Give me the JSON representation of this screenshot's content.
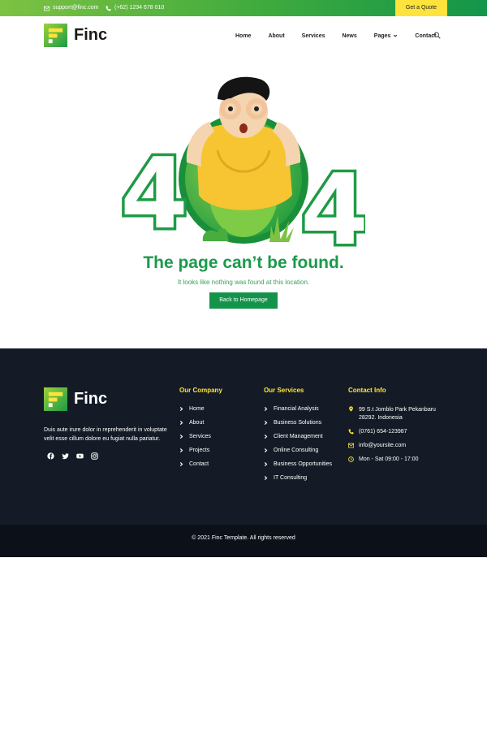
{
  "topbar": {
    "email": "support@finc.com",
    "phone": "(+62) 1234 678 010",
    "quote_label": "Get a Quote"
  },
  "nav": {
    "brand": "Finc",
    "items": [
      "Home",
      "About",
      "Services",
      "News",
      "Pages",
      "Contact"
    ]
  },
  "hero": {
    "code_left": "4",
    "code_right": "4",
    "title": "The page can’t be found.",
    "subtitle": "It looks like nothing was found at this location.",
    "button": "Back to Homepage"
  },
  "footer": {
    "brand": "Finc",
    "about": "Duis aute irure dolor in reprehenderit in voluptate velit esse cillum dolore eu fugiat nulla pariatur.",
    "social_icons": [
      "facebook-icon",
      "twitter-icon",
      "youtube-icon",
      "instagram-icon"
    ],
    "company": {
      "title": "Our Company",
      "items": [
        "Home",
        "About",
        "Services",
        "Projects",
        "Contact"
      ]
    },
    "services": {
      "title": "Our Services",
      "items": [
        "Financial Analysis",
        "Business Solutions",
        "Client Management",
        "Online Consulting",
        "Business Opportunities",
        "IT Consulting"
      ]
    },
    "contact": {
      "title": "Contact Info",
      "address": "99 S.t Jomblo Park Pekanbaru 28292. Indonesia",
      "phone": "(0761) 654-123987",
      "email": "info@yoursite.com",
      "hours": "Mon - Sat 09:00 - 17:00"
    },
    "copyright": "© 2021 Finc Template. All rights reserved"
  },
  "colors": {
    "brand_green": "#14934a",
    "accent_yellow": "#fde33c",
    "footer_bg": "#141b26"
  }
}
